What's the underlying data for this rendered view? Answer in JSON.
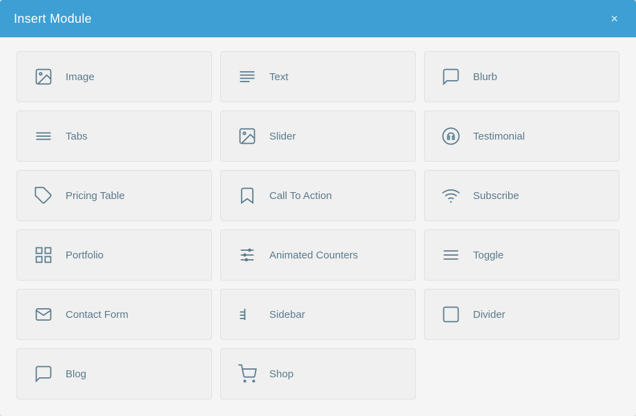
{
  "modal": {
    "title": "Insert Module",
    "close_label": "×"
  },
  "modules": [
    {
      "id": "image",
      "label": "Image",
      "icon": "image"
    },
    {
      "id": "text",
      "label": "Text",
      "icon": "text"
    },
    {
      "id": "blurb",
      "label": "Blurb",
      "icon": "blurb"
    },
    {
      "id": "tabs",
      "label": "Tabs",
      "icon": "tabs"
    },
    {
      "id": "slider",
      "label": "Slider",
      "icon": "slider"
    },
    {
      "id": "testimonial",
      "label": "Testimonial",
      "icon": "testimonial"
    },
    {
      "id": "pricing-table",
      "label": "Pricing Table",
      "icon": "pricing"
    },
    {
      "id": "call-to-action",
      "label": "Call To Action",
      "icon": "cta"
    },
    {
      "id": "subscribe",
      "label": "Subscribe",
      "icon": "subscribe"
    },
    {
      "id": "portfolio",
      "label": "Portfolio",
      "icon": "portfolio"
    },
    {
      "id": "animated-counters",
      "label": "Animated Counters",
      "icon": "counters"
    },
    {
      "id": "toggle",
      "label": "Toggle",
      "icon": "toggle"
    },
    {
      "id": "contact-form",
      "label": "Contact Form",
      "icon": "contactform"
    },
    {
      "id": "sidebar",
      "label": "Sidebar",
      "icon": "sidebar"
    },
    {
      "id": "divider",
      "label": "Divider",
      "icon": "divider"
    },
    {
      "id": "blog",
      "label": "Blog",
      "icon": "blog"
    },
    {
      "id": "shop",
      "label": "Shop",
      "icon": "shop"
    }
  ]
}
